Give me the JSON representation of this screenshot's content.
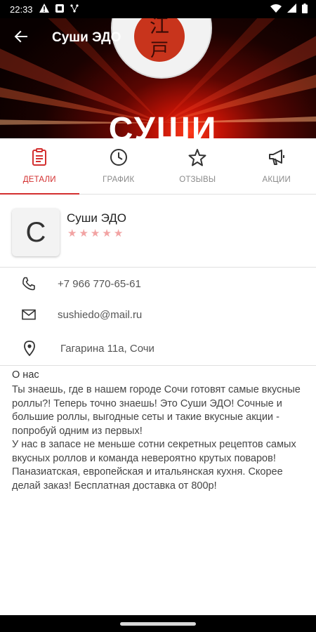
{
  "status_bar": {
    "time": "22:33"
  },
  "appbar": {
    "title": "Суши ЭДО"
  },
  "hero": {
    "logo_text": "СУШИ"
  },
  "tabs": [
    {
      "label": "ДЕТАЛИ",
      "icon": "clipboard-icon",
      "active": true
    },
    {
      "label": "ГРАФИК",
      "icon": "clock-icon",
      "active": false
    },
    {
      "label": "ОТЗЫВЫ",
      "icon": "star-outline-icon",
      "active": false
    },
    {
      "label": "АКЦИИ",
      "icon": "megaphone-icon",
      "active": false
    }
  ],
  "venue": {
    "avatar_letter": "С",
    "name": "Суши ЭДО",
    "rating": 0,
    "max_rating": 5
  },
  "contacts": {
    "phone": "+7 966 770-65-61",
    "email": "sushiedo@mail.ru",
    "address": "Гагарина 11а, Сочи"
  },
  "about": {
    "title": "О нас",
    "text": "Ты знаешь, где в нашем городе Сочи готовят самые вкусные роллы?! Теперь точно знаешь! Это Суши ЭДО! Сочные и большие роллы, выгодные сеты и такие вкусные акции - попробуй одним из первых!\nУ нас в запасе не меньше сотни секретных рецептов самых вкусных роллов и команда невероятно крутых поваров! Паназиатская, европейская и итальянская кухня. Скорее делай заказ! Бесплатная доставка от 800р!"
  },
  "colors": {
    "accent": "#d32f2f",
    "star_empty": "#f2a3a3",
    "text_secondary": "#555555"
  }
}
